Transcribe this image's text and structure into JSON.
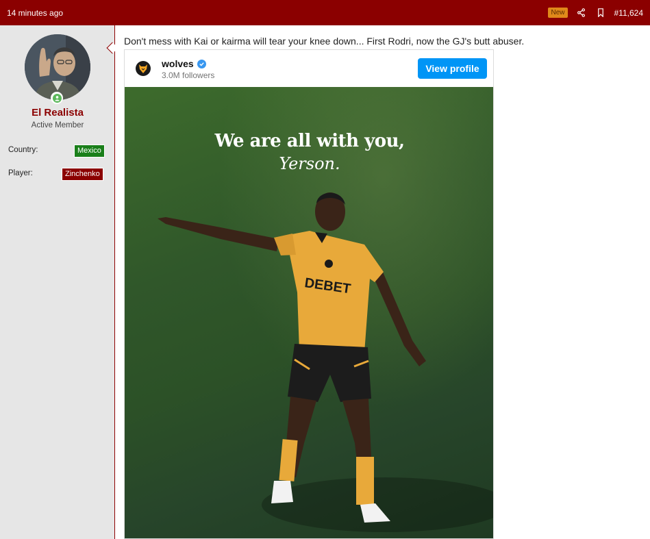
{
  "header": {
    "time_ago": "14 minutes ago",
    "new_badge": "New",
    "post_number": "#11,624",
    "icons": [
      "share-icon",
      "bookmark-icon"
    ]
  },
  "user": {
    "name": "El Realista",
    "title": "Active Member",
    "fields": [
      {
        "label": "Country:",
        "value": "Mexico",
        "color": "#1a7f1a"
      },
      {
        "label": "Player:",
        "value": "Zinchenko",
        "color": "#8b0000"
      }
    ]
  },
  "post": {
    "message": "Don't mess with Kai or kairma will tear your knee down... First Rodri, now the GJ's butt abuser."
  },
  "embed": {
    "account": "wolves",
    "followers": "3.0M followers",
    "button": "View profile",
    "headline_line1": "We are all with you,",
    "headline_line2": "Yerson.",
    "shirt_sponsor": "DEBET"
  },
  "colors": {
    "brand": "#8b0000",
    "new_badge": "#e0891a",
    "instagram_blue": "#0095f6"
  }
}
